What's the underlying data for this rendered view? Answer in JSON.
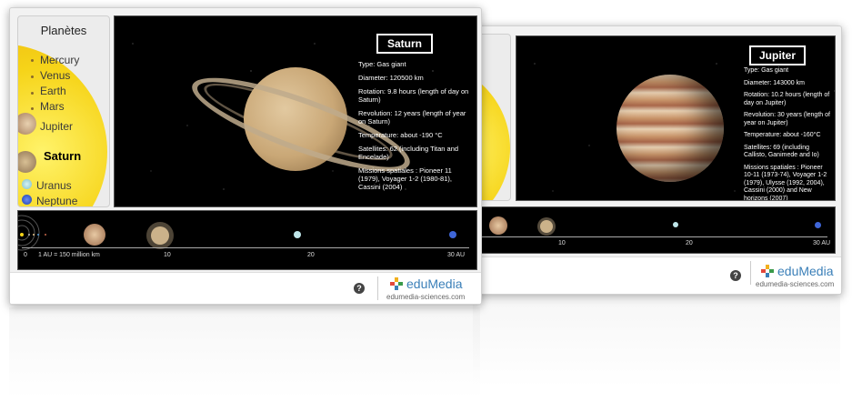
{
  "front": {
    "panel_title": "Planètes",
    "planets": [
      {
        "name": "Mercury"
      },
      {
        "name": "Venus"
      },
      {
        "name": "Earth"
      },
      {
        "name": "Mars"
      },
      {
        "name": "Jupiter"
      },
      {
        "name": "Saturn",
        "selected": true
      },
      {
        "name": "Uranus"
      },
      {
        "name": "Neptune"
      }
    ],
    "selected_name": "Saturn",
    "info": [
      "Type: Gas giant",
      "Diameter: 120500 km",
      "Rotation: 9.8 hours (length of day on Saturn)",
      "Revolution: 12 years (length of year on Saturn)",
      "Temperature: about -190 °C",
      "Satellites: 62 (including Titan and Encelade)",
      "Missions spatiales : Pioneer 11 (1979), Voyager 1-2 (1980-81), Cassini (2004)"
    ],
    "scale": {
      "origin": "0",
      "au_note": "1 AU = 150 million km",
      "t10": "10",
      "t20": "20",
      "t30": "30 AU"
    }
  },
  "back": {
    "selected_name": "Jupiter",
    "info": [
      "Type: Gas giant",
      "Diameter: 143000 km",
      "Rotation: 10.2 hours (length of day on Jupiter)",
      "Revolution: 30 years (length of year on Jupiter)",
      "Temperature: about -160°C",
      "Satellites: 69 (including Callisto, Ganimede and Io)",
      "Missions spatiales : Pioneer 10-11 (1973-74), Voyager 1-2 (1979), Ulysse (1992, 2004), Cassini (2000) and New horizons (2007)"
    ],
    "scale": {
      "t10": "10",
      "t20": "20",
      "t30": "30 AU"
    }
  },
  "footer": {
    "help": "?",
    "brand": "eduMedia",
    "url": "edumedia-sciences.com"
  },
  "colors": {
    "brand": "#3a7fb8",
    "sun": "#f6d419"
  }
}
